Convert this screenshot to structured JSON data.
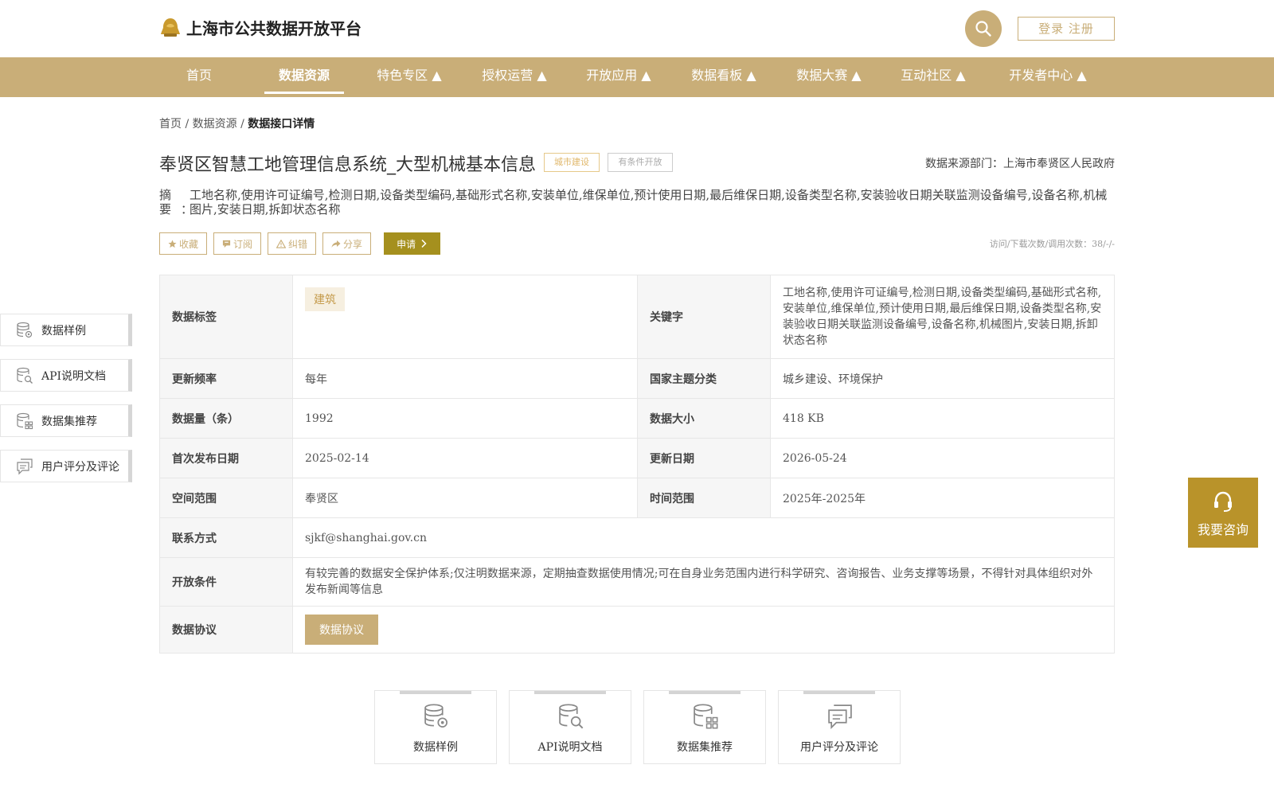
{
  "header": {
    "site_title": "上海市公共数据开放平台",
    "login_label": "登录 注册"
  },
  "nav": {
    "items": [
      {
        "label": "首页"
      },
      {
        "label": "数据资源"
      },
      {
        "label": "特色专区 ▲"
      },
      {
        "label": "授权运营 ▲"
      },
      {
        "label": "开放应用 ▲"
      },
      {
        "label": "数据看板 ▲"
      },
      {
        "label": "数据大赛 ▲"
      },
      {
        "label": "互动社区 ▲"
      },
      {
        "label": "开发者中心 ▲"
      }
    ],
    "active": "数据资源"
  },
  "breadcrumb": {
    "home": "首页",
    "sep": "/",
    "level2": "数据资源",
    "current": "数据接口详情"
  },
  "dataset": {
    "title": "奉贤区智慧工地管理信息系统_大型机械基本信息",
    "tag_domain": "城市建设",
    "tag_open": "有条件开放",
    "source_label": "数据来源部门：上海市奉贤区人民政府",
    "summary_label": "摘要：",
    "summary_text": "工地名称,使用许可证编号,检测日期,设备类型编码,基础形式名称,安装单位,维保单位,预计使用日期,最后维保日期,设备类型名称,安装验收日期关联监测设备编号,设备名称,机械图片,安装日期,拆卸状态名称"
  },
  "actions": {
    "collect": "收藏",
    "subscribe": "订阅",
    "correct": "纠错",
    "share": "分享",
    "apply": "申请",
    "stats": "访问/下载次数/调用次数：38/-/-"
  },
  "details": {
    "tag_key": "数据标签",
    "tag_value": "建筑",
    "keyword_key": "关键字",
    "keyword_value": "工地名称,使用许可证编号,检测日期,设备类型编码,基础形式名称,安装单位,维保单位,预计使用日期,最后维保日期,设备类型名称,安装验收日期关联监测设备编号,设备名称,机械图片,安装日期,拆卸状态名称",
    "freq_key": "更新频率",
    "freq_value": "每年",
    "theme_key": "国家主题分类",
    "theme_value": "城乡建设、环境保护",
    "count_key": "数据量（条）",
    "count_value": "1992",
    "size_key": "数据大小",
    "size_value": "418 KB",
    "first_key": "首次发布日期",
    "first_value": "2025-02-14",
    "update_key": "更新日期",
    "update_value": "2026-05-24",
    "space_key": "空间范围",
    "space_value": "奉贤区",
    "time_key": "时间范围",
    "time_value": "2025年-2025年",
    "contact_key": "联系方式",
    "contact_value": "sjkf@shanghai.gov.cn",
    "cond_key": "开放条件",
    "cond_value": "有较完善的数据安全保护体系;仅注明数据来源，定期抽查数据使用情况;可在自身业务范围内进行科学研究、咨询报告、业务支撑等场景，不得针对具体组织对外发布新闻等信息",
    "agree_key": "数据协议",
    "agree_button": "数据协议"
  },
  "sidebar": {
    "items": [
      {
        "label": "数据样例",
        "icon": "database-gear-icon"
      },
      {
        "label": "API说明文档",
        "icon": "database-search-icon"
      },
      {
        "label": "数据集推荐",
        "icon": "database-grid-icon"
      },
      {
        "label": "用户评分及评论",
        "icon": "comment-icon"
      }
    ]
  },
  "consult": {
    "label": "我要咨询"
  },
  "cards": {
    "items": [
      {
        "label": "数据样例"
      },
      {
        "label": "API说明文档"
      },
      {
        "label": "数据集推荐"
      },
      {
        "label": "用户评分及评论"
      }
    ]
  },
  "colors": {
    "brand": "#c9ae78",
    "apply": "#a5901e",
    "consult": "#b9932a"
  }
}
